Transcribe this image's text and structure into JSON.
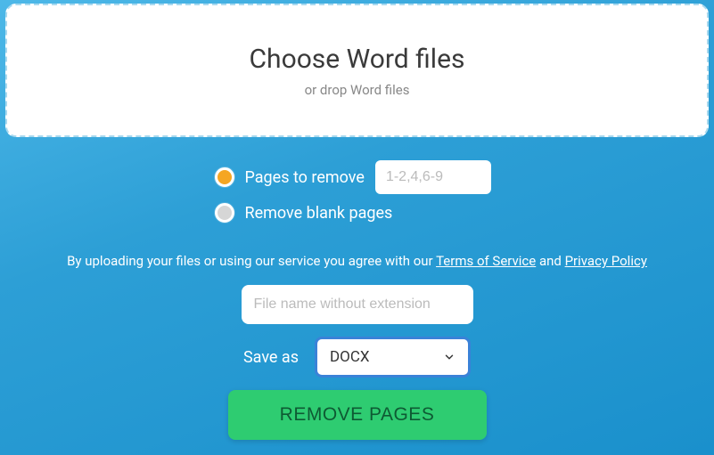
{
  "dropzone": {
    "title": "Choose Word files",
    "subtitle": "or drop Word files"
  },
  "options": {
    "pages_to_remove_label": "Pages to remove",
    "pages_placeholder": "1-2,4,6-9",
    "remove_blank_label": "Remove blank pages"
  },
  "terms": {
    "prefix": "By uploading your files or using our service you agree with our ",
    "tos": "Terms of Service",
    "and": " and ",
    "privacy": "Privacy Policy"
  },
  "form": {
    "filename_placeholder": "File name without extension",
    "saveas_label": "Save as",
    "format_selected": "DOCX",
    "submit_label": "REMOVE PAGES"
  }
}
